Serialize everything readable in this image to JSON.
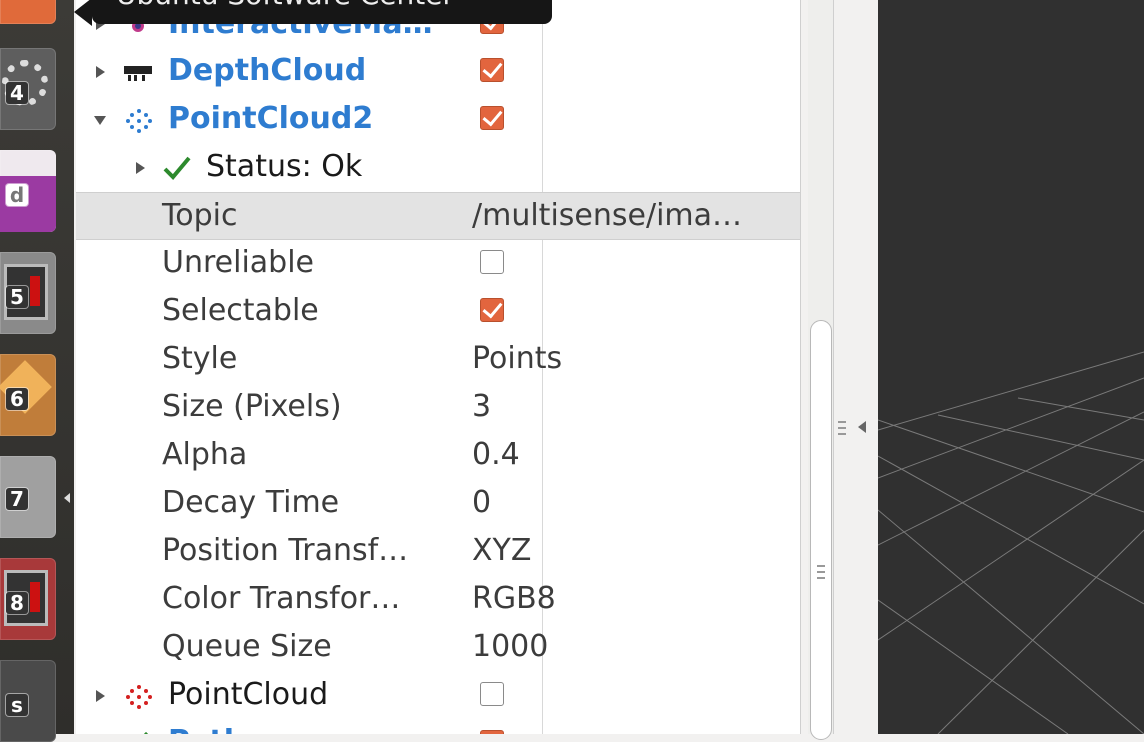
{
  "tooltip": {
    "text": "Ubuntu Software Center"
  },
  "launcher": {
    "items": [
      {
        "num": "",
        "color": "#e06a3a"
      },
      {
        "num": "4",
        "color": "#6a6a6a"
      },
      {
        "num": "d",
        "color": "#9b3aa2"
      },
      {
        "num": "5",
        "color": "#7a7a7a"
      },
      {
        "num": "6",
        "color": "#b5702f"
      },
      {
        "num": "7",
        "color": "#8e8e8e"
      },
      {
        "num": "8",
        "color": "#a8393a"
      },
      {
        "num": "s",
        "color": "#4a4a4a"
      }
    ]
  },
  "tree": {
    "rows": [
      {
        "label": "InteractiveMa…",
        "checked": true
      },
      {
        "label": "DepthCloud",
        "checked": true
      },
      {
        "label": "PointCloud2",
        "checked": true
      },
      {
        "label": "Status: Ok"
      },
      {
        "label": "Topic",
        "value": "/multisense/ima…"
      },
      {
        "label": "Unreliable",
        "checked": false
      },
      {
        "label": "Selectable",
        "checked": true
      },
      {
        "label": "Style",
        "value": "Points"
      },
      {
        "label": "Size (Pixels)",
        "value": "3"
      },
      {
        "label": "Alpha",
        "value": "0.4"
      },
      {
        "label": "Decay Time",
        "value": "0"
      },
      {
        "label": "Position Transf…",
        "value": "XYZ"
      },
      {
        "label": "Color Transfor…",
        "value": "RGB8"
      },
      {
        "label": "Queue Size",
        "value": "1000"
      },
      {
        "label": "PointCloud",
        "checked": false
      },
      {
        "label": "Path",
        "checked": true
      }
    ]
  },
  "colors": {
    "accent_checkbox": "#e2653e",
    "display_name_blue": "#2e7cd0",
    "status_ok_green": "#2d8a2d",
    "viewport_bg": "#303030"
  }
}
